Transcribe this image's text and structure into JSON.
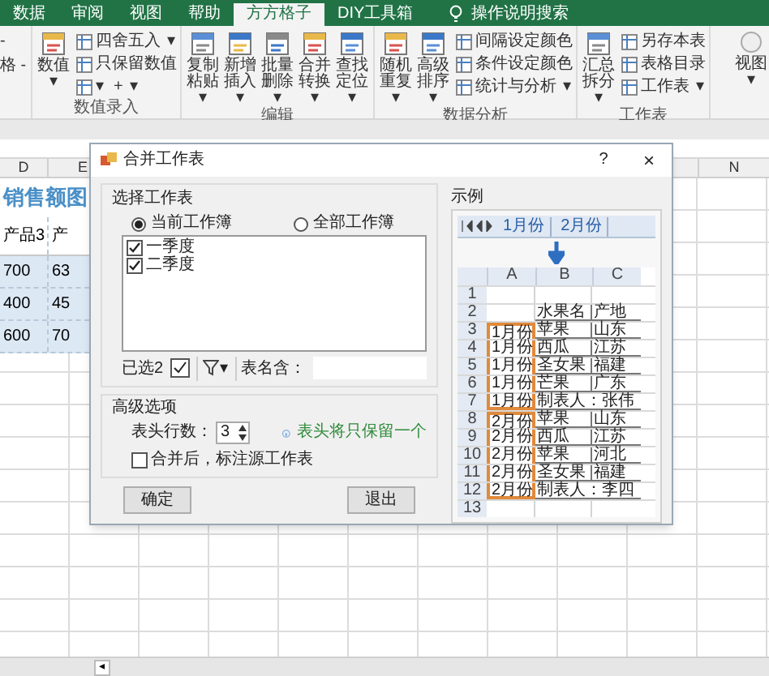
{
  "ribbon": {
    "tabs": [
      {
        "label": "数据",
        "selected": false
      },
      {
        "label": "审阅",
        "selected": false
      },
      {
        "label": "视图",
        "selected": false
      },
      {
        "label": "帮助",
        "selected": false
      },
      {
        "label": "方方格子",
        "selected": true
      },
      {
        "label": "DIY工具箱",
        "selected": false
      }
    ],
    "search": "操作说明搜索",
    "left_cut": [
      "-",
      "格 -"
    ],
    "groups": [
      {
        "title": "数值录入",
        "large": [
          {
            "label": "数值",
            "caret": "▾"
          }
        ],
        "small": [
          {
            "label": "四舍五入",
            "caret": "▾"
          },
          {
            "label": "只保留数值"
          },
          {
            "icon_caret": "▾",
            "label": "+",
            "caret": "▾"
          }
        ]
      },
      {
        "title": "编辑",
        "large": [
          {
            "label": "复制粘贴",
            "caret": "▾"
          },
          {
            "label": "新增插入",
            "caret": "▾"
          },
          {
            "label": "批量删除",
            "caret": "▾"
          },
          {
            "label": "合并转换",
            "caret": "▾"
          },
          {
            "label": "查找定位",
            "caret": "▾"
          }
        ]
      },
      {
        "title": "数据分析",
        "large": [
          {
            "label": "随机重复",
            "caret": "▾"
          },
          {
            "label": "高级排序",
            "caret": "▾"
          }
        ],
        "small": [
          {
            "label": "间隔设定颜色"
          },
          {
            "label": "条件设定颜色"
          },
          {
            "label": "统计与分析",
            "caret": "▾"
          }
        ]
      },
      {
        "title": "工作表",
        "large": [
          {
            "label": "汇总拆分",
            "caret": "▾"
          }
        ],
        "small": [
          {
            "label": "另存本表"
          },
          {
            "label": "表格目录"
          },
          {
            "label": "工作表",
            "caret": "▾"
          }
        ]
      }
    ],
    "right_cut": {
      "label": "视图",
      "caret": "▾"
    }
  },
  "sheet": {
    "columns": [
      "D",
      "E",
      "N"
    ],
    "title": "销售额图",
    "rows": [
      {
        "kind": "header",
        "cells": [
          "产品3",
          "产"
        ]
      },
      {
        "kind": "data",
        "cells": [
          "700",
          "63"
        ]
      },
      {
        "kind": "data",
        "cells": [
          "400",
          "45"
        ]
      },
      {
        "kind": "data",
        "cells": [
          "600",
          "70"
        ]
      }
    ],
    "sheet_nav": "◂"
  },
  "dialog": {
    "title": "合并工作表",
    "help": "?",
    "close": "×",
    "select_group": {
      "title": "选择工作表",
      "radios": [
        {
          "label": "当前工作簿",
          "selected": true
        },
        {
          "label": "全部工作簿",
          "selected": false
        }
      ],
      "sheets": [
        {
          "label": "一季度",
          "checked": true
        },
        {
          "label": "二季度",
          "checked": true
        }
      ],
      "selected_count": "已选2",
      "filter_caret": "▾",
      "name_filter_label": "表名含："
    },
    "advanced": {
      "title": "高级选项",
      "header_rows_label": "表头行数：",
      "header_rows_value": "3",
      "info": "表头将只保留一个",
      "mark_source": {
        "label": "合并后，标注源工作表",
        "checked": false
      }
    },
    "buttons": [
      "确定",
      "退出"
    ],
    "example": {
      "title": "示例",
      "tabs": [
        "1月份",
        "2月份"
      ],
      "columns": [
        "A",
        "B",
        "C"
      ],
      "rows": [
        {
          "n": "1",
          "kind": "data"
        },
        {
          "n": "2",
          "kind": "data",
          "b": "水果名",
          "c": "产地"
        },
        {
          "n": "3",
          "kind": "data",
          "a": "1月份",
          "b": "苹果",
          "c": "山东",
          "group_start": true,
          "group_end": false
        },
        {
          "n": "4",
          "kind": "data",
          "a": "1月份",
          "b": "西瓜",
          "c": "江苏",
          "group_start": false,
          "group_end": false
        },
        {
          "n": "5",
          "kind": "data",
          "a": "1月份",
          "b": "圣女果",
          "c": "福建",
          "group_start": false,
          "group_end": false
        },
        {
          "n": "6",
          "kind": "data",
          "a": "1月份",
          "b": "芒果",
          "c": "广东",
          "group_start": false,
          "group_end": false
        },
        {
          "n": "7",
          "kind": "merged",
          "a": "1月份",
          "b": "制表人：张伟",
          "group_start": false,
          "group_end": true
        },
        {
          "n": "8",
          "kind": "data",
          "a": "2月份",
          "b": "苹果",
          "c": "山东",
          "group_start": true,
          "group_end": false
        },
        {
          "n": "9",
          "kind": "data",
          "a": "2月份",
          "b": "西瓜",
          "c": "江苏",
          "group_start": false,
          "group_end": false
        },
        {
          "n": "10",
          "kind": "data",
          "a": "2月份",
          "b": "苹果",
          "c": "河北",
          "group_start": false,
          "group_end": false
        },
        {
          "n": "11",
          "kind": "data",
          "a": "2月份",
          "b": "圣女果",
          "c": "福建",
          "group_start": false,
          "group_end": false
        },
        {
          "n": "12",
          "kind": "merged",
          "a": "2月份",
          "b": "制表人：李四",
          "group_start": false,
          "group_end": true
        },
        {
          "n": "13",
          "kind": "data"
        }
      ]
    }
  }
}
